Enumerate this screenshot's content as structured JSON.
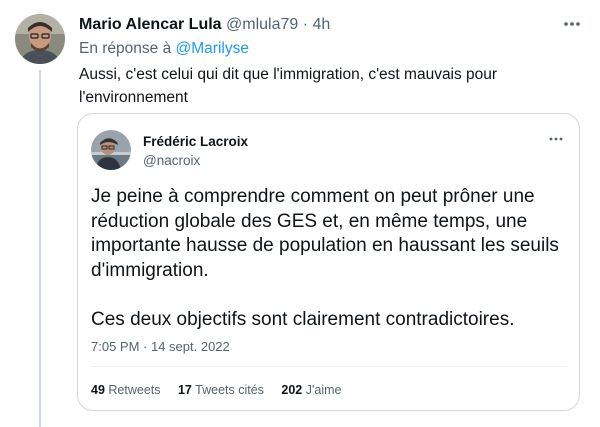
{
  "tweet": {
    "author_name": "Mario Alencar Lula",
    "author_handle": "@mlula79",
    "separator": "·",
    "time": "4h",
    "reply_prefix": "En réponse à",
    "reply_mention": "@Marilyse",
    "text": "Aussi, c'est celui qui dit que l'immigration, c'est mauvais pour l'environnement",
    "more_icon": "more-horizontal-icon"
  },
  "quoted": {
    "author_name": "Frédéric Lacroix",
    "author_handle": "@nacroix",
    "paragraph_1": "Je peine à comprendre comment on peut prôner une réduction globale des GES et, en même temps, une importante hausse de population en haussant les seuils d'immigration.",
    "paragraph_2": "Ces deux objectifs sont clairement contradictoires.",
    "timestamp": "7:05 PM · 14 sept. 2022",
    "stats": {
      "retweets_count": "49",
      "retweets_label": "Retweets",
      "quotes_count": "17",
      "quotes_label": "Tweets cités",
      "likes_count": "202",
      "likes_label": "J'aime"
    }
  },
  "colors": {
    "text_primary": "#0f1419",
    "text_secondary": "#536471",
    "accent": "#1d9bf0",
    "border": "#cfd9de"
  }
}
